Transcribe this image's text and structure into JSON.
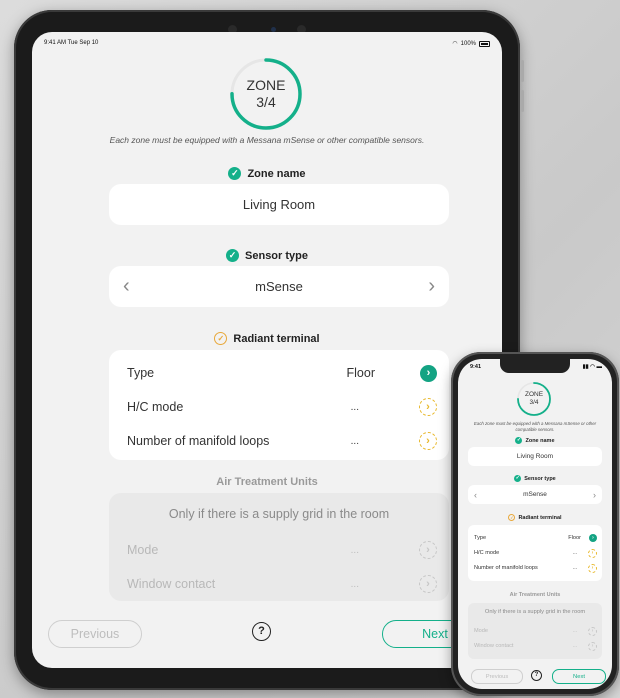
{
  "tablet": {
    "status": {
      "time": "9:41 AM  Tue Sep 10",
      "battery": "100%"
    },
    "zone": {
      "label": "ZONE",
      "progress": "3/4",
      "fraction": 0.75
    },
    "subtitle": "Each zone must be equipped with a Messana mSense or other compatible sensors.",
    "zone_name": {
      "title": "Zone name",
      "value": "Living Room"
    },
    "sensor_type": {
      "title": "Sensor type",
      "value": "mSense"
    },
    "radiant": {
      "title": "Radiant terminal",
      "rows": [
        {
          "label": "Type",
          "value": "Floor"
        },
        {
          "label": "H/C mode",
          "value": "..."
        },
        {
          "label": "Number of manifold loops",
          "value": "..."
        }
      ]
    },
    "air": {
      "title": "Air Treatment Units",
      "note": "Only if there is a supply grid in the room",
      "rows": [
        {
          "label": "Mode",
          "value": "..."
        },
        {
          "label": "Window contact",
          "value": "..."
        }
      ]
    },
    "buttons": {
      "previous": "Previous",
      "next": "Next",
      "help": "?"
    }
  },
  "phone": {
    "status": {
      "time": "9:41"
    },
    "zone": {
      "label": "ZONE",
      "progress": "3/4"
    },
    "subtitle": "Each zone must be equipped with a Messana mSense or other compatible sensors.",
    "zone_name": {
      "title": "Zone name",
      "value": "Living Room"
    },
    "sensor_type": {
      "title": "Sensor type",
      "value": "mSense"
    },
    "radiant": {
      "title": "Radiant terminal",
      "rows": [
        {
          "label": "Type",
          "value": "Floor"
        },
        {
          "label": "H/C mode",
          "value": "..."
        },
        {
          "label": "Number of manifold loops",
          "value": "..."
        }
      ]
    },
    "air": {
      "title": "Air Treatment Units",
      "note": "Only if there is a supply grid in the room",
      "rows": [
        {
          "label": "Mode",
          "value": "..."
        },
        {
          "label": "Window contact",
          "value": "..."
        }
      ]
    },
    "buttons": {
      "previous": "Previous",
      "next": "Next",
      "help": "?"
    }
  },
  "colors": {
    "accent": "#14b08a",
    "warning": "#e8b92e",
    "background": "#f2f2f2"
  }
}
